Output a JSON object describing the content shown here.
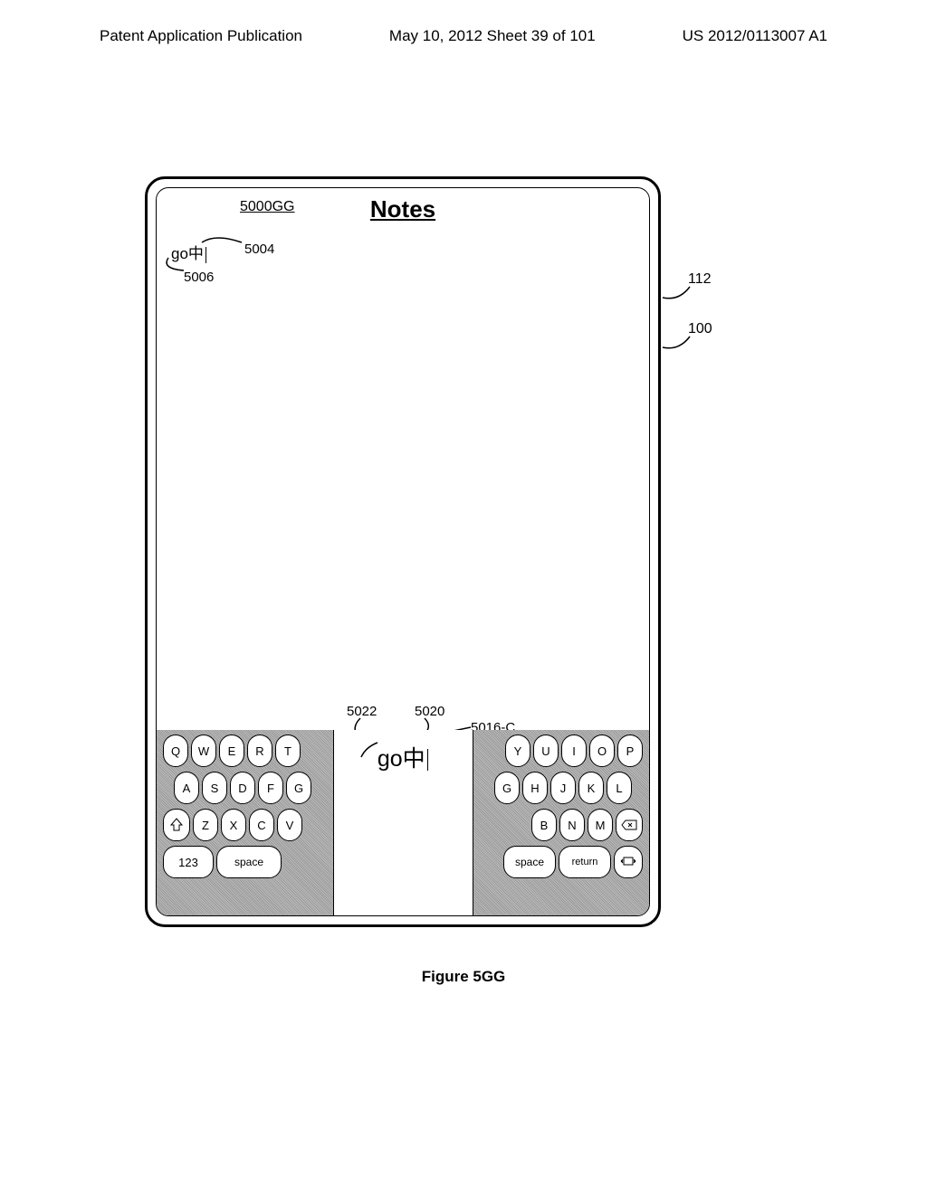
{
  "header": {
    "left": "Patent Application Publication",
    "center": "May 10, 2012  Sheet 39 of 101",
    "right": "US 2012/0113007 A1"
  },
  "device": {
    "figure_ref": "5000GG",
    "app_title": "Notes",
    "input_text": "go中",
    "ref_5004": "5004",
    "ref_5006": "5006",
    "ref_5022": "5022",
    "ref_5020": "5020",
    "ref_5016c": "5016-C",
    "center_text": "go中"
  },
  "keyboard": {
    "left": {
      "row1": [
        "Q",
        "W",
        "E",
        "R",
        "T"
      ],
      "row2": [
        "A",
        "S",
        "D",
        "F",
        "G"
      ],
      "row3": [
        "Z",
        "X",
        "C",
        "V"
      ],
      "key_123": "123",
      "key_space": "space"
    },
    "right": {
      "row1": [
        "Y",
        "U",
        "I",
        "O",
        "P"
      ],
      "row2": [
        "G",
        "H",
        "J",
        "K",
        "L"
      ],
      "row3": [
        "B",
        "N",
        "M"
      ],
      "key_space": "space",
      "key_return": "return"
    }
  },
  "outer_refs": {
    "ref_112": "112",
    "ref_100": "100"
  },
  "figure_caption": "Figure 5GG"
}
